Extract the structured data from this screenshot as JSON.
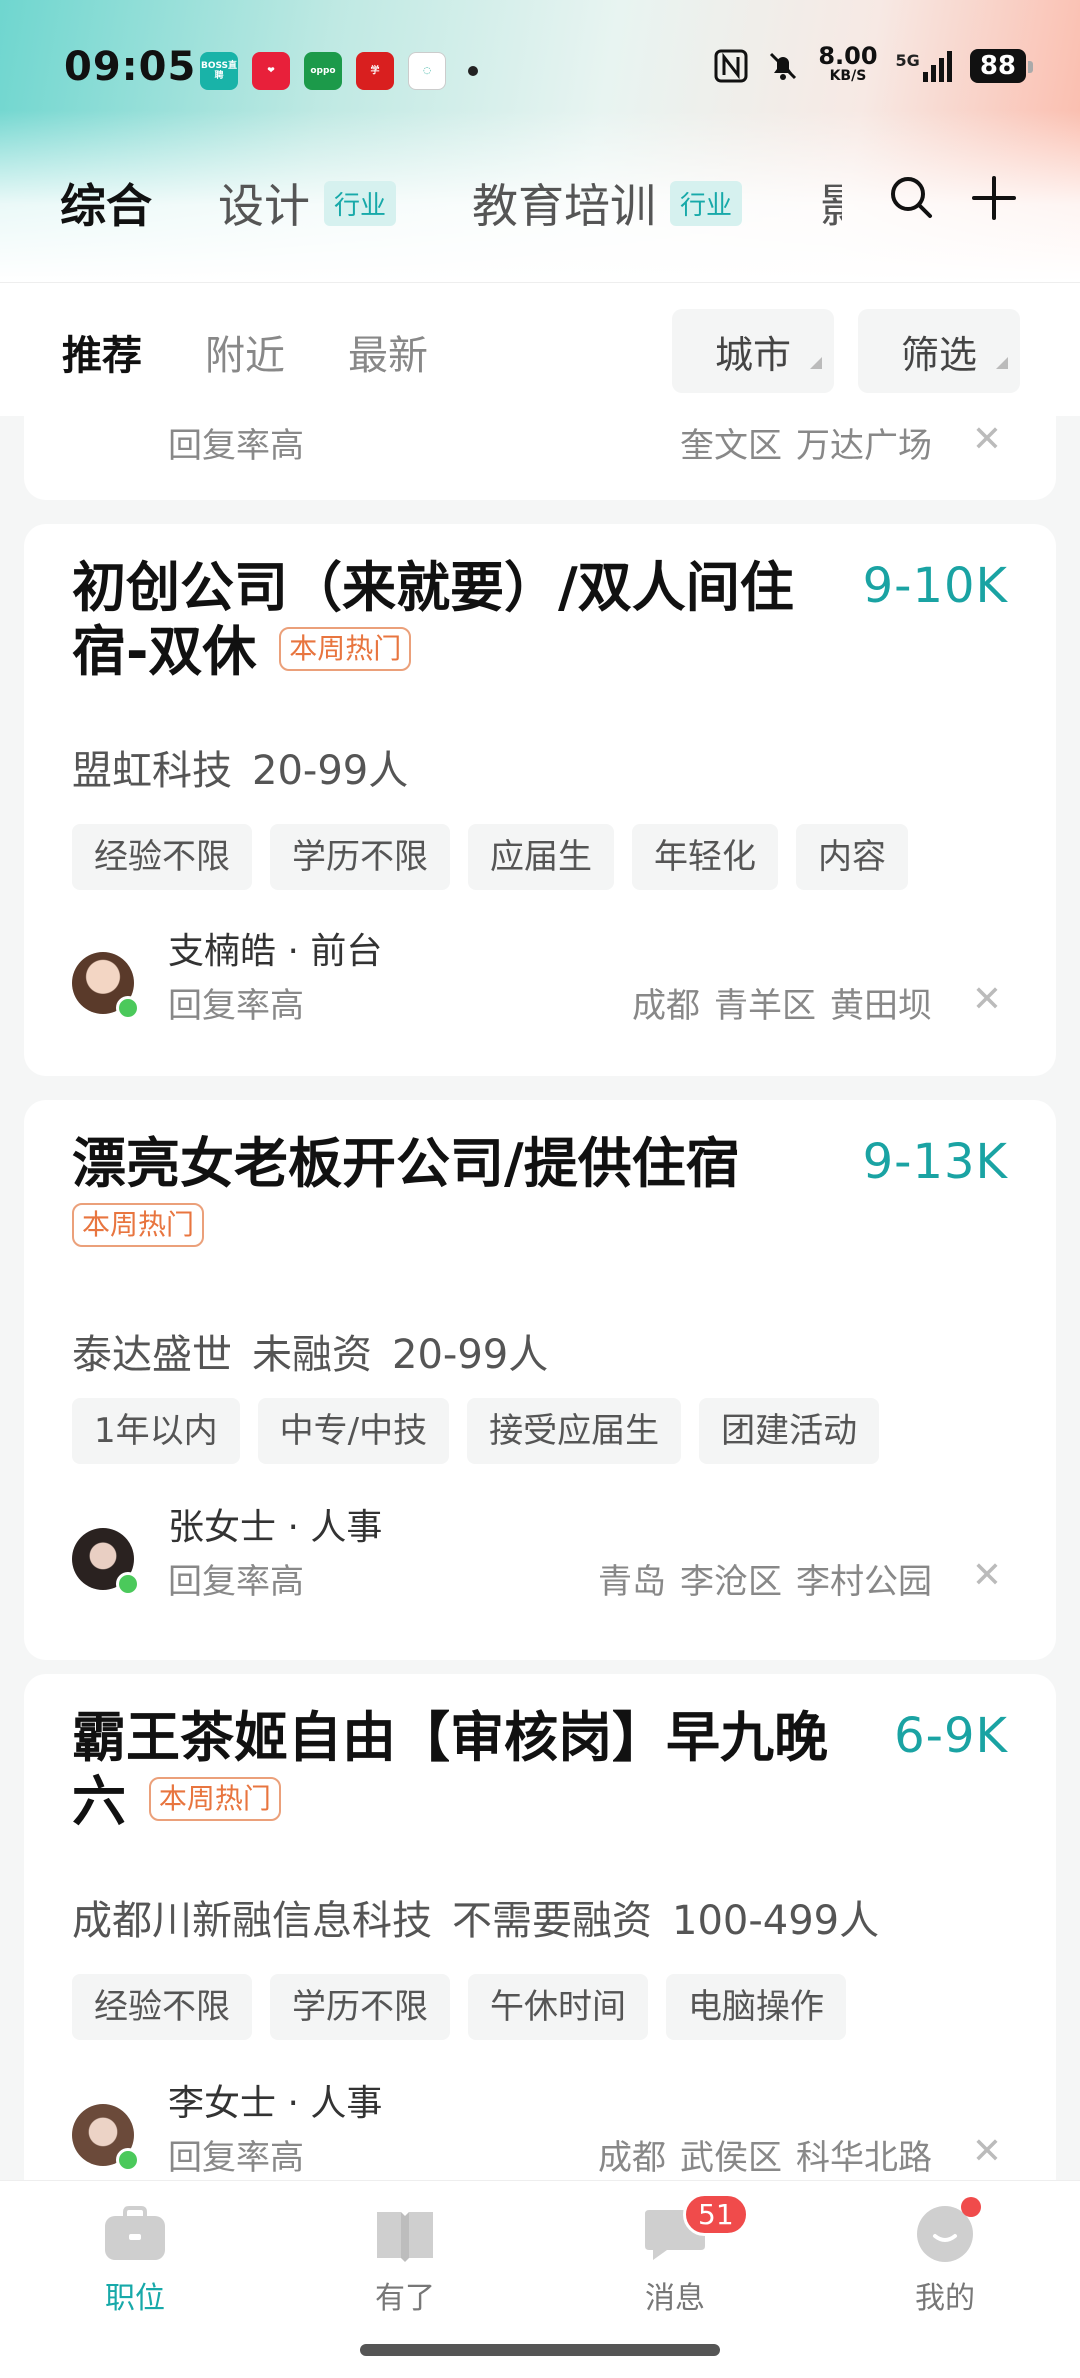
{
  "status": {
    "time": "09:05",
    "apps": [
      "BOSS直聘",
      "",
      "oppo",
      "",
      ""
    ],
    "net_speed": "8.00",
    "net_unit": "KB/S",
    "signal": "5G",
    "battery": "88"
  },
  "category_tabs": [
    {
      "label": "综合",
      "badge": ""
    },
    {
      "label": "设计",
      "badge": "行业"
    },
    {
      "label": "教育培训",
      "badge": "行业"
    },
    {
      "label": "影",
      "badge": ""
    }
  ],
  "sub_tabs": [
    "推荐",
    "附近",
    "最新"
  ],
  "filters": {
    "city": "城市",
    "screen": "筛选"
  },
  "partial_card": {
    "reply": "回复率高",
    "location": [
      "奎文区",
      "万达广场"
    ]
  },
  "jobs": [
    {
      "title": "初创公司（来就要）/双人间住宿-双休",
      "hot": "本周热门",
      "salary": "9-10K",
      "company": [
        "盟虹科技",
        "20-99人"
      ],
      "tags": [
        "经验不限",
        "学历不限",
        "应届生",
        "年轻化",
        "内容"
      ],
      "boss": "支楠皓 · 前台",
      "reply": "回复率高",
      "location": [
        "成都",
        "青羊区",
        "黄田坝"
      ]
    },
    {
      "title": "漂亮女老板开公司/提供住宿",
      "hot": "本周热门",
      "salary": "9-13K",
      "company": [
        "泰达盛世",
        "未融资",
        "20-99人"
      ],
      "tags": [
        "1年以内",
        "中专/中技",
        "接受应届生",
        "团建活动"
      ],
      "boss": "张女士 · 人事",
      "reply": "回复率高",
      "location": [
        "青岛",
        "李沧区",
        "李村公园"
      ]
    },
    {
      "title": "霸王茶姬自由【审核岗】早九晚六",
      "hot": "本周热门",
      "salary": "6-9K",
      "company": [
        "成都川新融信息科技",
        "不需要融资",
        "100-499人"
      ],
      "tags": [
        "经验不限",
        "学历不限",
        "午休时间",
        "电脑操作"
      ],
      "boss": "李女士 · 人事",
      "reply": "回复率高",
      "location": [
        "成都",
        "武侯区",
        "科华北路"
      ]
    }
  ],
  "bottom_nav": [
    {
      "label": "职位",
      "icon": "briefcase-icon"
    },
    {
      "label": "有了",
      "icon": "book-icon"
    },
    {
      "label": "消息",
      "icon": "chat-icon",
      "badge": "51"
    },
    {
      "label": "我的",
      "icon": "profile-icon"
    }
  ],
  "colors": {
    "accent": "#17a9a9",
    "hot": "#e8753f",
    "online": "#4bc95b",
    "badge": "#f04b4b"
  }
}
